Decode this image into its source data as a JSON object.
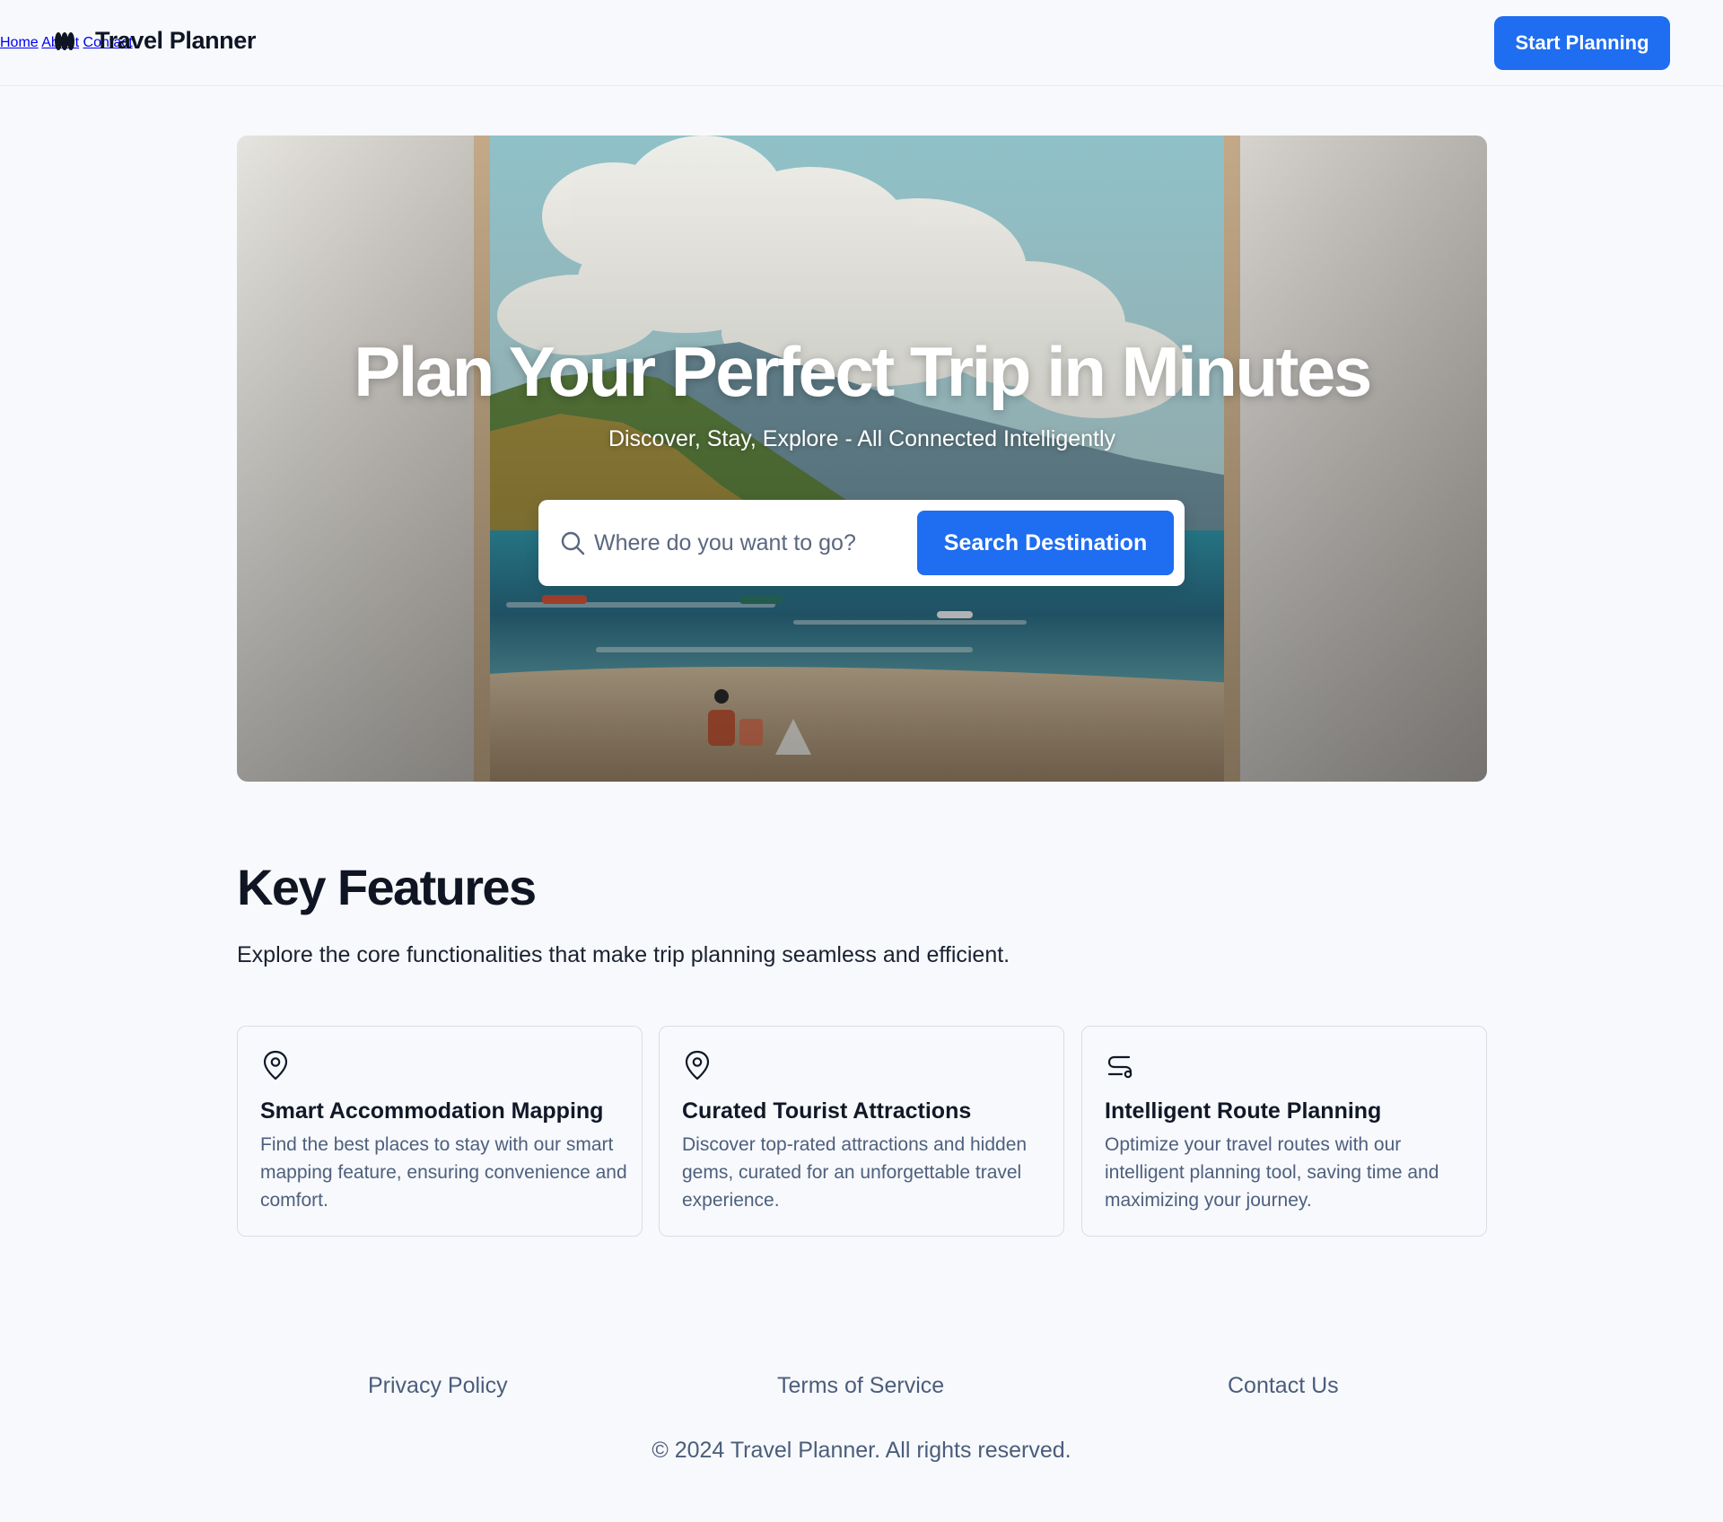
{
  "header": {
    "brand": "Travel Planner",
    "nav": [
      "Home",
      "About",
      "Contact"
    ],
    "cta_label": "Start Planning"
  },
  "hero": {
    "title": "Plan Your Perfect Trip in Minutes",
    "subtitle": "Discover, Stay, Explore - All Connected Intelligently",
    "search_placeholder": "Where do you want to go?",
    "search_button": "Search Destination"
  },
  "features": {
    "title": "Key Features",
    "description": "Explore the core functionalities that make trip planning seamless and efficient.",
    "cards": [
      {
        "icon": "map-pin-icon",
        "title": "Smart Accommodation Mapping",
        "text": "Find the best places to stay with our smart mapping feature, ensuring convenience and comfort."
      },
      {
        "icon": "map-pin-icon",
        "title": "Curated Tourist Attractions",
        "text": "Discover top-rated attractions and hidden gems, curated for an unforgettable travel experience."
      },
      {
        "icon": "route-icon",
        "title": "Intelligent Route Planning",
        "text": "Optimize your travel routes with our intelligent planning tool, saving time and maximizing your journey."
      }
    ]
  },
  "footer": {
    "links": [
      "Privacy Policy",
      "Terms of Service",
      "Contact Us"
    ],
    "copyright": "© 2024 Travel Planner. All rights reserved."
  },
  "colors": {
    "accent": "#1f6df0",
    "background": "#f7f9fc",
    "muted_text": "#4b5d7c"
  }
}
